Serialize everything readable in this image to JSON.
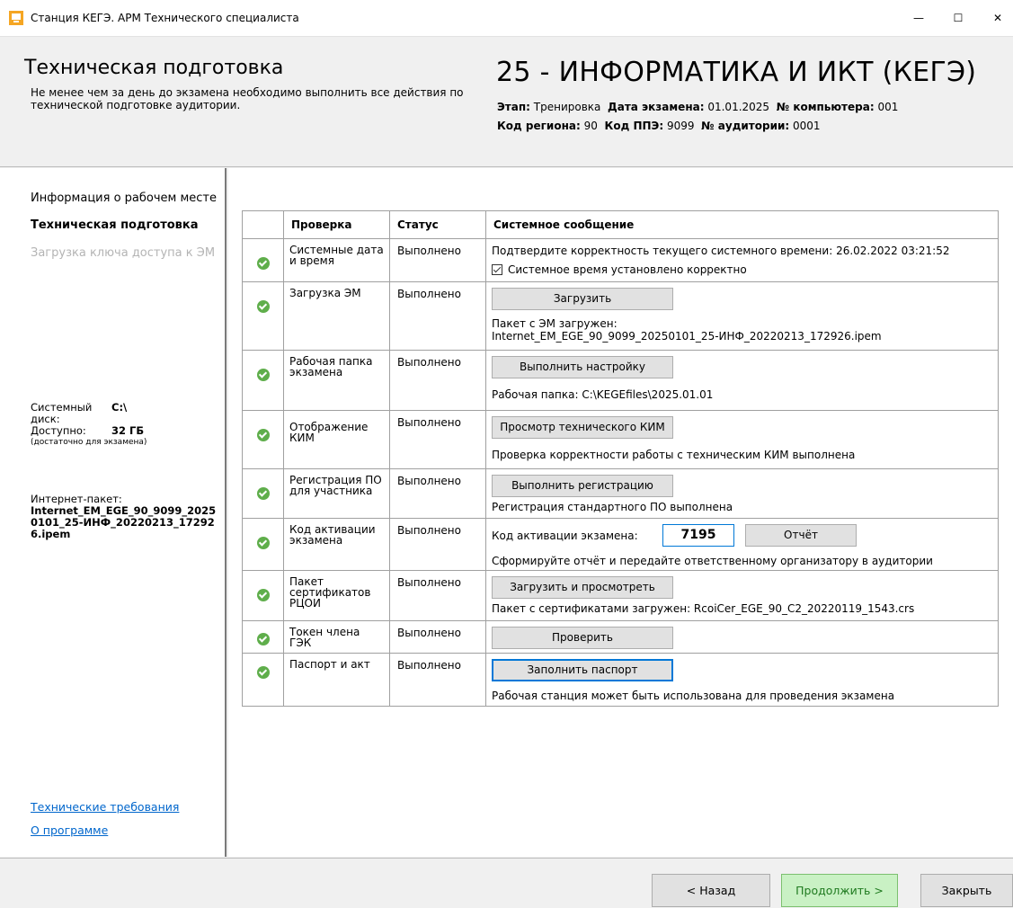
{
  "window": {
    "title": "Станция КЕГЭ. АРМ Технического специалиста",
    "min_glyph": "—",
    "max_glyph": "☐",
    "close_glyph": "✕"
  },
  "header": {
    "title": "Техническая подготовка",
    "subtitle": "Не менее чем за день до экзамена необходимо выполнить все действия по технической подготовке аудитории.",
    "exam": "25 - ИНФОРМАТИКА И ИКТ (КЕГЭ)",
    "stage_label": "Этап:",
    "stage_value": "Тренировка",
    "date_label": "Дата экзамена:",
    "date_value": "01.01.2025",
    "computer_label": "№ компьютера:",
    "computer_value": "001",
    "region_label": "Код региона:",
    "region_value": "90",
    "ppe_label": "Код ППЭ:",
    "ppe_value": "9099",
    "room_label": "№ аудитории:",
    "room_value": "0001"
  },
  "sidebar": {
    "nav": [
      "Информация о рабочем месте",
      "Техническая подготовка",
      "Загрузка ключа доступа к ЭМ"
    ],
    "disk_label": "Системный диск:",
    "disk_value": "C:\\",
    "free_label": "Доступно:",
    "free_value": "32 ГБ",
    "free_note": "(достаточно для экзамена)",
    "pkg_label": "Интернет-пакет:",
    "pkg_value": "Internet_EM_EGE_90_9099_20250101_25-ИНФ_20220213_172926.ipem",
    "link_requirements": "Технические требования",
    "link_about": "О программе"
  },
  "table": {
    "headers": [
      "Проверка",
      "Статус",
      "Системное сообщение"
    ],
    "status_done": "Выполнено",
    "rows": [
      {
        "check": "Системные дата и время",
        "msg1": "Подтвердите корректность текущего системного времени: 26.02.2022 03:21:52",
        "checkbox": "Системное время установлено корректно"
      },
      {
        "check": "Загрузка ЭМ",
        "button": "Загрузить",
        "msg1": "Пакет с ЭМ загружен:",
        "msg2": "Internet_EM_EGE_90_9099_20250101_25-ИНФ_20220213_172926.ipem"
      },
      {
        "check": "Рабочая папка экзамена",
        "button": "Выполнить настройку",
        "msg1": "Рабочая папка: C:\\KEGEfiles\\2025.01.01"
      },
      {
        "check": "Отображение КИМ",
        "button": "Просмотр технического КИМ",
        "msg1": "Проверка корректности работы с техническим КИМ выполнена"
      },
      {
        "check": "Регистрация ПО для участника",
        "button": "Выполнить регистрацию",
        "msg1": "Регистрация стандартного ПО выполнена"
      },
      {
        "check": "Код активации экзамена",
        "label": "Код активации экзамена:",
        "code": "7195",
        "button": "Отчёт",
        "msg1": "Сформируйте отчёт и передайте ответственному организатору в аудитории"
      },
      {
        "check": "Пакет сертификатов РЦОИ",
        "button": "Загрузить и просмотреть",
        "msg1": "Пакет с сертификатами загружен: RcoiCer_EGE_90_C2_20220119_1543.crs"
      },
      {
        "check": "Токен члена ГЭК",
        "button": "Проверить"
      },
      {
        "check": "Паспорт и акт",
        "button": "Заполнить паспорт",
        "msg1": "Рабочая станция может быть использована для проведения экзамена"
      }
    ]
  },
  "footer": {
    "back": "< Назад",
    "next": "Продолжить >",
    "close": "Закрыть"
  },
  "colors": {
    "ok": "#5fae4b",
    "accent": "#0078d7",
    "next_bg": "#c9f1c4"
  }
}
